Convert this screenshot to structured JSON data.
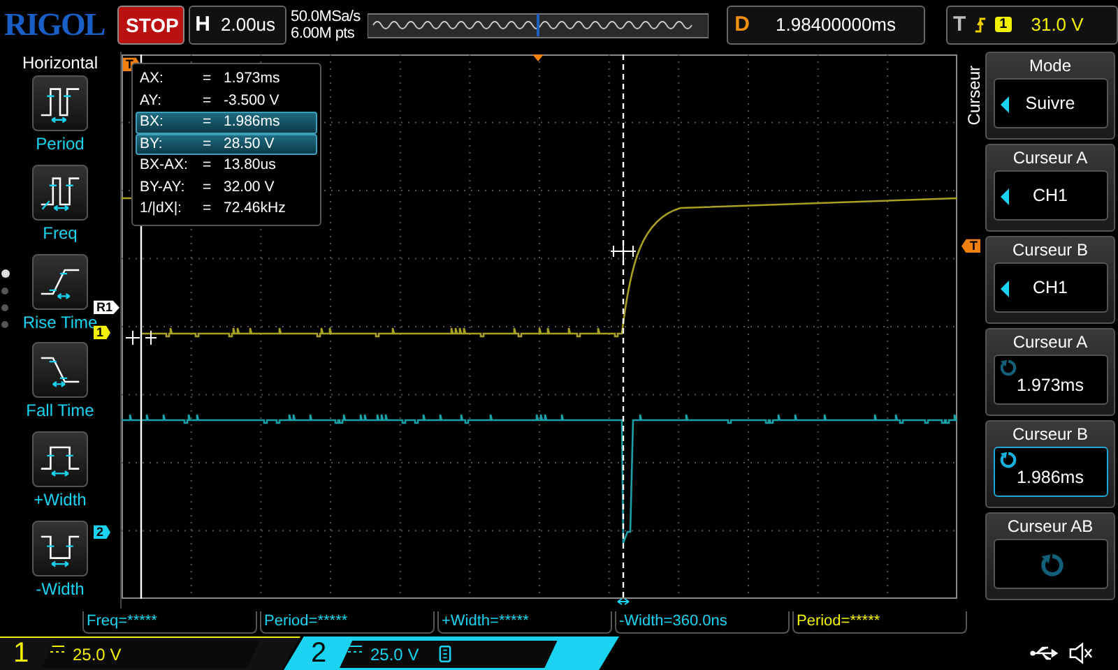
{
  "brand": {
    "logo": "RIGOL"
  },
  "run_state": {
    "label": "STOP"
  },
  "timebase": {
    "label": "H",
    "value": "2.00us"
  },
  "acquisition": {
    "sample_rate": "50.0MSa/s",
    "memory_depth": "6.00M pts"
  },
  "delay": {
    "label": "D",
    "value": "1.98400000ms"
  },
  "trigger": {
    "label": "T",
    "source": "1",
    "level": "31.0 V"
  },
  "sidebar": {
    "title": "Horizontal",
    "pages": [
      {
        "selected": true
      },
      {
        "selected": false
      },
      {
        "selected": false
      },
      {
        "selected": false
      }
    ],
    "items": [
      {
        "label": "Period"
      },
      {
        "label": "Freq"
      },
      {
        "label": "Rise Time"
      },
      {
        "label": "Fall Time"
      },
      {
        "label": "+Width"
      },
      {
        "label": "-Width"
      }
    ]
  },
  "grid_markers": {
    "trigger_time": "T",
    "trigger_level": "T",
    "reference": "R1",
    "channel_1": "1",
    "channel_2": "2"
  },
  "cursor_readout": [
    {
      "label": "AX:",
      "eq": "=",
      "value": "1.973ms",
      "selected": false
    },
    {
      "label": "AY:",
      "eq": "=",
      "value": "-3.500 V",
      "selected": false
    },
    {
      "label": "BX:",
      "eq": "=",
      "value": "1.986ms",
      "selected": true
    },
    {
      "label": "BY:",
      "eq": "=",
      "value": "28.50 V",
      "selected": true
    },
    {
      "label": "BX-AX:",
      "eq": "=",
      "value": "13.80us",
      "selected": false
    },
    {
      "label": "BY-AY:",
      "eq": "=",
      "value": "32.00 V",
      "selected": false
    },
    {
      "label": "1/|dX|:",
      "eq": "=",
      "value": "72.46kHz",
      "selected": false
    }
  ],
  "menu": {
    "title": "Curseur",
    "items": [
      {
        "kind": "choice",
        "title": "Mode",
        "value": "Suivre",
        "selected": false
      },
      {
        "kind": "choice",
        "title": "Curseur A",
        "value": "CH1",
        "selected": false
      },
      {
        "kind": "choice",
        "title": "Curseur B",
        "value": "CH1",
        "selected": false
      },
      {
        "kind": "knob",
        "title": "Curseur A",
        "value": "1.973ms",
        "selected": false
      },
      {
        "kind": "knob",
        "title": "Curseur B",
        "value": "1.986ms",
        "selected": true
      },
      {
        "kind": "knob",
        "title": "Curseur AB",
        "selected": false
      }
    ]
  },
  "measurements": [
    {
      "text": "Freq=*****",
      "color": "#19d3f0"
    },
    {
      "text": "Period=*****",
      "color": "#19d3f0"
    },
    {
      "text": "+Width=*****",
      "color": "#19d3f0"
    },
    {
      "text": "-Width=360.0ns",
      "color": "#19d3f0"
    },
    {
      "text": "Period=*****",
      "color": "#f0f000"
    }
  ],
  "channels": [
    {
      "number": "1",
      "scale": "25.0 V",
      "color": "#f0f000",
      "selected": false,
      "bandwidth_limit": false
    },
    {
      "number": "2",
      "scale": "25.0 V",
      "color": "#19d3f0",
      "selected": true,
      "bandwidth_limit": true
    }
  ]
}
